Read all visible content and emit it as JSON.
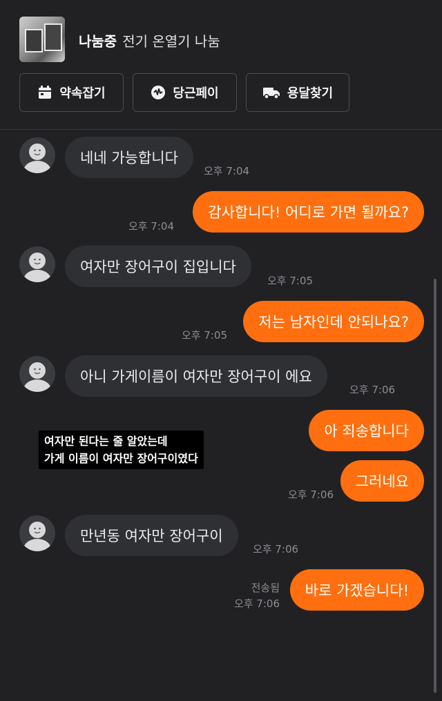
{
  "header": {
    "status": "나눔중",
    "title": "전기 온열기 나눔",
    "buttons": [
      {
        "label": "약속잡기",
        "icon": "calendar-icon"
      },
      {
        "label": "당근페이",
        "icon": "pay-icon"
      },
      {
        "label": "용달찾기",
        "icon": "truck-icon"
      }
    ]
  },
  "messages": [
    {
      "side": "in",
      "text": "네네 가능합니다",
      "time": "오후 7:04"
    },
    {
      "side": "out",
      "text": "감사합니다! 어디로 가면 될까요?",
      "time": "오후 7:04"
    },
    {
      "side": "in",
      "text": "여자만 장어구이 집입니다",
      "time": "오후 7:05"
    },
    {
      "side": "out",
      "text": "저는 남자인데 안되나요?",
      "time": "오후 7:05"
    },
    {
      "side": "in",
      "text": "아니 가게이름이 여자만 장어구이 에요",
      "time": "오후 7:06"
    },
    {
      "side": "out",
      "text": "아 죄송합니다",
      "time": ""
    },
    {
      "side": "out",
      "text": "그러네요",
      "time": "오후 7:06"
    },
    {
      "side": "in",
      "text": "만년동 여자만 장어구이",
      "time": "오후 7:06"
    },
    {
      "side": "out",
      "text": "바로 가겠습니다!",
      "time": "오후 7:06",
      "status": "전송됨"
    }
  ],
  "caption": {
    "line1": "여자만 된다는 줄 알았는데",
    "line2": "가게 이름이 여자만 장어구이였다"
  },
  "colors": {
    "background": "#212124",
    "outgoing_bubble": "#ff6f0f",
    "incoming_bubble": "#2f3034"
  }
}
